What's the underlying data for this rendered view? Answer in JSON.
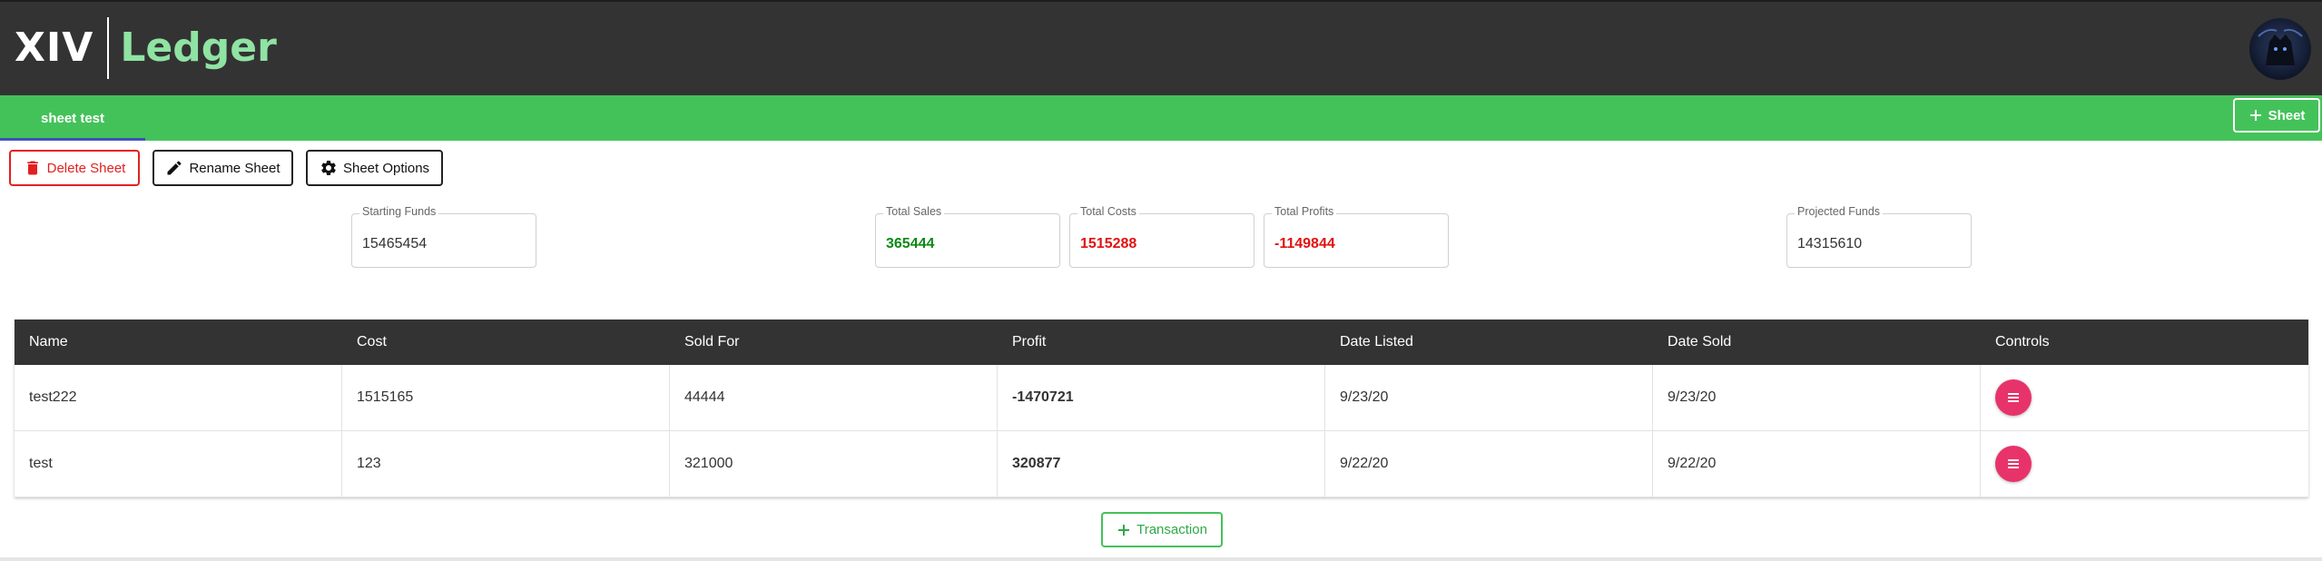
{
  "brand": {
    "primary": "XIV",
    "secondary": "Ledger"
  },
  "tabs": [
    {
      "label": "sheet test",
      "active": true
    }
  ],
  "add_sheet_label": "Sheet",
  "toolbar": {
    "delete_label": "Delete Sheet",
    "rename_label": "Rename Sheet",
    "options_label": "Sheet Options"
  },
  "stats": {
    "starting_funds": {
      "label": "Starting Funds",
      "value": "15465454"
    },
    "total_sales": {
      "label": "Total Sales",
      "value": "365444"
    },
    "total_costs": {
      "label": "Total Costs",
      "value": "1515288"
    },
    "total_profits": {
      "label": "Total Profits",
      "value": "-1149844"
    },
    "projected_funds": {
      "label": "Projected Funds",
      "value": "14315610"
    }
  },
  "table": {
    "headers": [
      "Name",
      "Cost",
      "Sold For",
      "Profit",
      "Date Listed",
      "Date Sold",
      "Controls"
    ],
    "rows": [
      {
        "name": "test222",
        "cost": "1515165",
        "sold_for": "44444",
        "profit": "-1470721",
        "date_listed": "9/23/20",
        "date_sold": "9/23/20"
      },
      {
        "name": "test",
        "cost": "123",
        "sold_for": "321000",
        "profit": "320877",
        "date_listed": "9/22/20",
        "date_sold": "9/22/20"
      }
    ]
  },
  "add_transaction_label": "Transaction",
  "colors": {
    "header_bg": "#333333",
    "accent_green": "#44c25a",
    "danger_red": "#e32020",
    "profit_green": "#0a8a14",
    "control_pink": "#e8336a"
  },
  "icons": [
    "trash-icon",
    "pencil-icon",
    "gear-icon",
    "plus-icon",
    "menu-icon"
  ]
}
